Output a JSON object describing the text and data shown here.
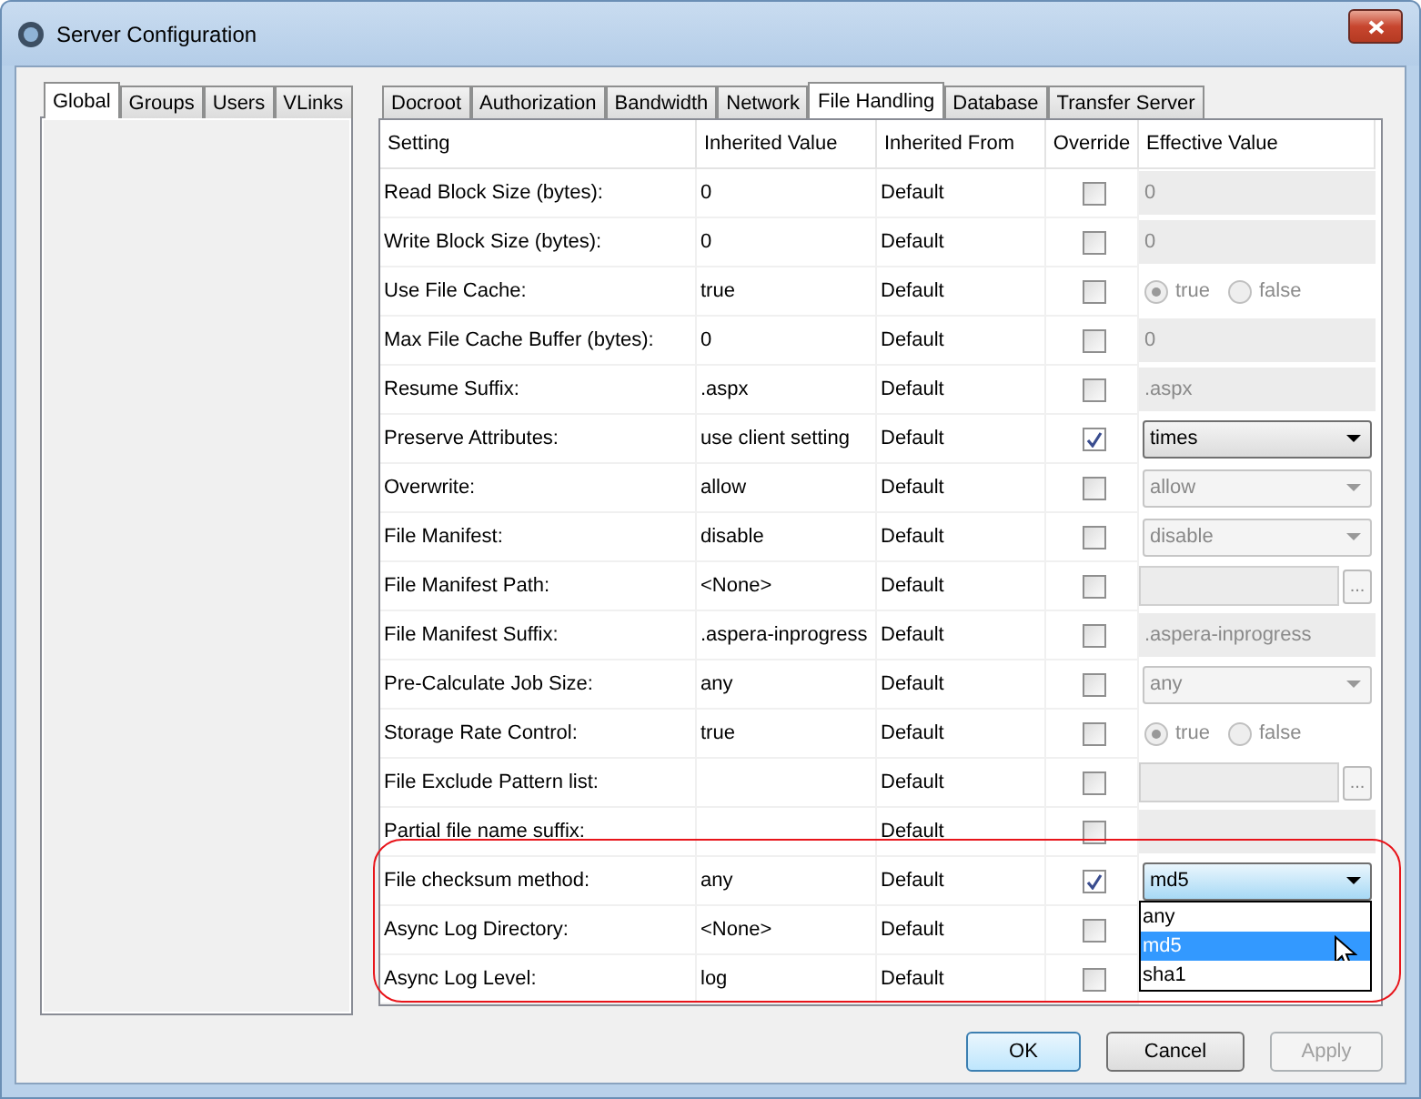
{
  "window": {
    "title": "Server Configuration"
  },
  "left_tabs": [
    {
      "label": "Global",
      "selected": true
    },
    {
      "label": "Groups",
      "selected": false
    },
    {
      "label": "Users",
      "selected": false
    },
    {
      "label": "VLinks",
      "selected": false
    }
  ],
  "right_tabs": [
    {
      "label": "Docroot",
      "selected": false
    },
    {
      "label": "Authorization",
      "selected": false
    },
    {
      "label": "Bandwidth",
      "selected": false
    },
    {
      "label": "Network",
      "selected": false
    },
    {
      "label": "File Handling",
      "selected": true
    },
    {
      "label": "Database",
      "selected": false
    },
    {
      "label": "Transfer Server",
      "selected": false
    }
  ],
  "table": {
    "columns": [
      "Setting",
      "Inherited Value",
      "Inherited From",
      "Override",
      "Effective Value"
    ],
    "rows": [
      {
        "setting": "Read Block Size (bytes):",
        "inherited_value": "0",
        "inherited_from": "Default",
        "override": false,
        "effective": {
          "kind": "text",
          "value": "0"
        }
      },
      {
        "setting": "Write Block Size (bytes):",
        "inherited_value": "0",
        "inherited_from": "Default",
        "override": false,
        "effective": {
          "kind": "text",
          "value": "0"
        }
      },
      {
        "setting": "Use File Cache:",
        "inherited_value": "true",
        "inherited_from": "Default",
        "override": false,
        "effective": {
          "kind": "radio",
          "options": [
            {
              "label": "true",
              "selected": true
            },
            {
              "label": "false",
              "selected": false
            }
          ]
        }
      },
      {
        "setting": "Max File Cache Buffer (bytes):",
        "inherited_value": "0",
        "inherited_from": "Default",
        "override": false,
        "effective": {
          "kind": "text",
          "value": "0"
        }
      },
      {
        "setting": "Resume Suffix:",
        "inherited_value": ".aspx",
        "inherited_from": "Default",
        "override": false,
        "effective": {
          "kind": "text",
          "value": ".aspx"
        }
      },
      {
        "setting": "Preserve Attributes:",
        "inherited_value": "use client setting",
        "inherited_from": "Default",
        "override": true,
        "effective": {
          "kind": "select",
          "value": "times"
        }
      },
      {
        "setting": "Overwrite:",
        "inherited_value": "allow",
        "inherited_from": "Default",
        "override": false,
        "effective": {
          "kind": "select",
          "value": "allow"
        }
      },
      {
        "setting": "File Manifest:",
        "inherited_value": "disable",
        "inherited_from": "Default",
        "override": false,
        "effective": {
          "kind": "select",
          "value": "disable"
        }
      },
      {
        "setting": "File Manifest Path:",
        "inherited_value": "<None>",
        "inherited_from": "Default",
        "override": false,
        "effective": {
          "kind": "browse",
          "button": "..."
        }
      },
      {
        "setting": "File Manifest Suffix:",
        "inherited_value": ".aspera-inprogress",
        "inherited_from": "Default",
        "override": false,
        "effective": {
          "kind": "text",
          "value": ".aspera-inprogress"
        }
      },
      {
        "setting": "Pre-Calculate Job Size:",
        "inherited_value": "any",
        "inherited_from": "Default",
        "override": false,
        "effective": {
          "kind": "select",
          "value": "any"
        }
      },
      {
        "setting": "Storage Rate Control:",
        "inherited_value": "true",
        "inherited_from": "Default",
        "override": false,
        "effective": {
          "kind": "radio",
          "options": [
            {
              "label": "true",
              "selected": true
            },
            {
              "label": "false",
              "selected": false
            }
          ]
        }
      },
      {
        "setting": "File Exclude Pattern list:",
        "inherited_from": "Default",
        "override": false,
        "effective": {
          "kind": "browse",
          "button": "..."
        }
      },
      {
        "setting": "Partial file name suffix:",
        "inherited_from": "Default",
        "override": false,
        "effective": {
          "kind": "text"
        }
      },
      {
        "setting": "File checksum method:",
        "inherited_value": "any",
        "inherited_from": "Default",
        "override": true,
        "effective": {
          "kind": "select",
          "value": "md5",
          "open": true,
          "options": [
            {
              "label": "any",
              "selected": false
            },
            {
              "label": "md5",
              "selected": true
            },
            {
              "label": "sha1",
              "selected": false
            }
          ]
        }
      },
      {
        "setting": "Async Log Directory:",
        "inherited_value": "<None>",
        "inherited_from": "Default",
        "override": false,
        "effective": {
          "kind": "none"
        }
      },
      {
        "setting": "Async Log Level:",
        "inherited_value": "log",
        "inherited_from": "Default",
        "override": false,
        "effective": {
          "kind": "none"
        }
      }
    ]
  },
  "buttons": [
    {
      "label": "OK",
      "disabled": false,
      "default": true
    },
    {
      "label": "Cancel",
      "disabled": false,
      "default": false
    },
    {
      "label": "Apply",
      "disabled": true,
      "default": false
    }
  ]
}
